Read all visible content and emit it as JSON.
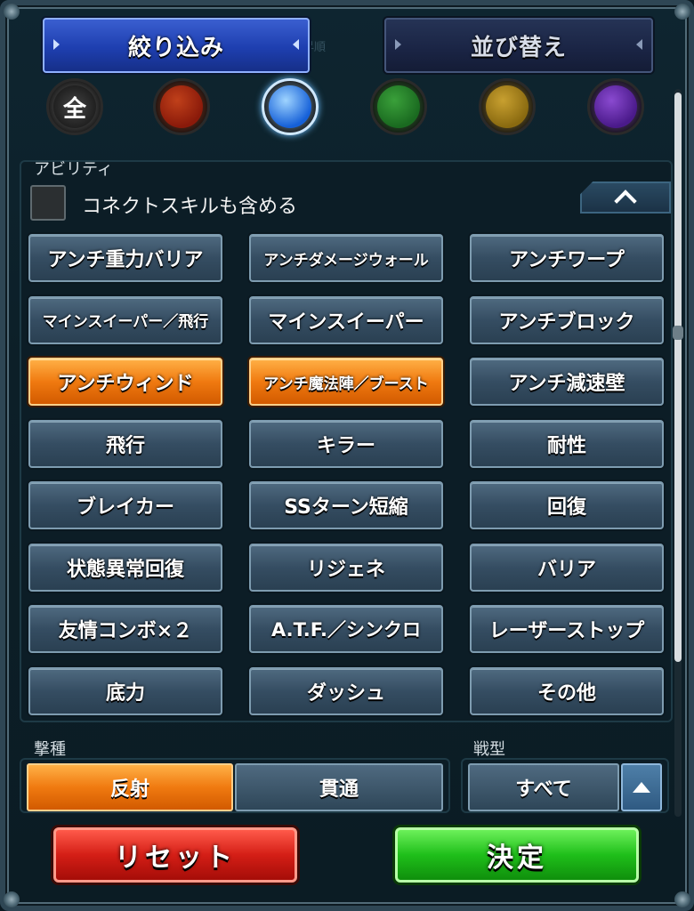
{
  "tabs": {
    "filter": "絞り込み",
    "sort": "並び替え",
    "ghost": "昇順"
  },
  "elements": [
    {
      "name": "all",
      "label": "全",
      "color": "#1a1a1a",
      "ring": "#8a8a8a",
      "active": false
    },
    {
      "name": "fire",
      "label": "",
      "color": "#8a1a0a",
      "ring": "#c0401a",
      "active": false
    },
    {
      "name": "water",
      "label": "",
      "color": "#1560d8",
      "ring": "#9fd4ff",
      "active": true
    },
    {
      "name": "wood",
      "label": "",
      "color": "#1a6a20",
      "ring": "#3aa03a",
      "active": false
    },
    {
      "name": "light",
      "label": "",
      "color": "#8a6a10",
      "ring": "#c8a030",
      "active": false
    },
    {
      "name": "dark",
      "label": "",
      "color": "#4a1a8a",
      "ring": "#8a4ad0",
      "active": false
    }
  ],
  "ability": {
    "title": "アビリティ",
    "connect_label": "コネクトスキルも含める",
    "buttons": [
      {
        "label": "アンチ重力バリア",
        "on": false,
        "size": 22
      },
      {
        "label": "アンチダメージウォール",
        "on": false,
        "size": 17
      },
      {
        "label": "アンチワープ",
        "on": false,
        "size": 22
      },
      {
        "label": "マインスイーパー／飛行",
        "on": false,
        "size": 17
      },
      {
        "label": "マインスイーパー",
        "on": false,
        "size": 22
      },
      {
        "label": "アンチブロック",
        "on": false,
        "size": 22
      },
      {
        "label": "アンチウィンド",
        "on": true,
        "size": 22
      },
      {
        "label": "アンチ魔法陣／ブースト",
        "on": true,
        "size": 17
      },
      {
        "label": "アンチ減速壁",
        "on": false,
        "size": 22
      },
      {
        "label": "飛行",
        "on": false,
        "size": 22
      },
      {
        "label": "キラー",
        "on": false,
        "size": 22
      },
      {
        "label": "耐性",
        "on": false,
        "size": 22
      },
      {
        "label": "ブレイカー",
        "on": false,
        "size": 22
      },
      {
        "label": "SSターン短縮",
        "on": false,
        "size": 22
      },
      {
        "label": "回復",
        "on": false,
        "size": 22
      },
      {
        "label": "状態異常回復",
        "on": false,
        "size": 22
      },
      {
        "label": "リジェネ",
        "on": false,
        "size": 22
      },
      {
        "label": "バリア",
        "on": false,
        "size": 22
      },
      {
        "label": "友情コンボ×２",
        "on": false,
        "size": 22
      },
      {
        "label": "A.T.F.／シンクロ",
        "on": false,
        "size": 21
      },
      {
        "label": "レーザーストップ",
        "on": false,
        "size": 22
      },
      {
        "label": "底力",
        "on": false,
        "size": 22
      },
      {
        "label": "ダッシュ",
        "on": false,
        "size": 22
      },
      {
        "label": "その他",
        "on": false,
        "size": 22
      }
    ]
  },
  "attack_type": {
    "title": "撃種",
    "reflect": "反射",
    "pierce": "貫通"
  },
  "battle_type": {
    "title": "戦型",
    "value": "すべて"
  },
  "actions": {
    "reset": "リセット",
    "confirm": "決定"
  },
  "colors": {
    "accent_orange": "#f07a10",
    "accent_blue": "#1e3fb0",
    "reset_red": "#d41e16",
    "confirm_green": "#1fbf1a"
  }
}
